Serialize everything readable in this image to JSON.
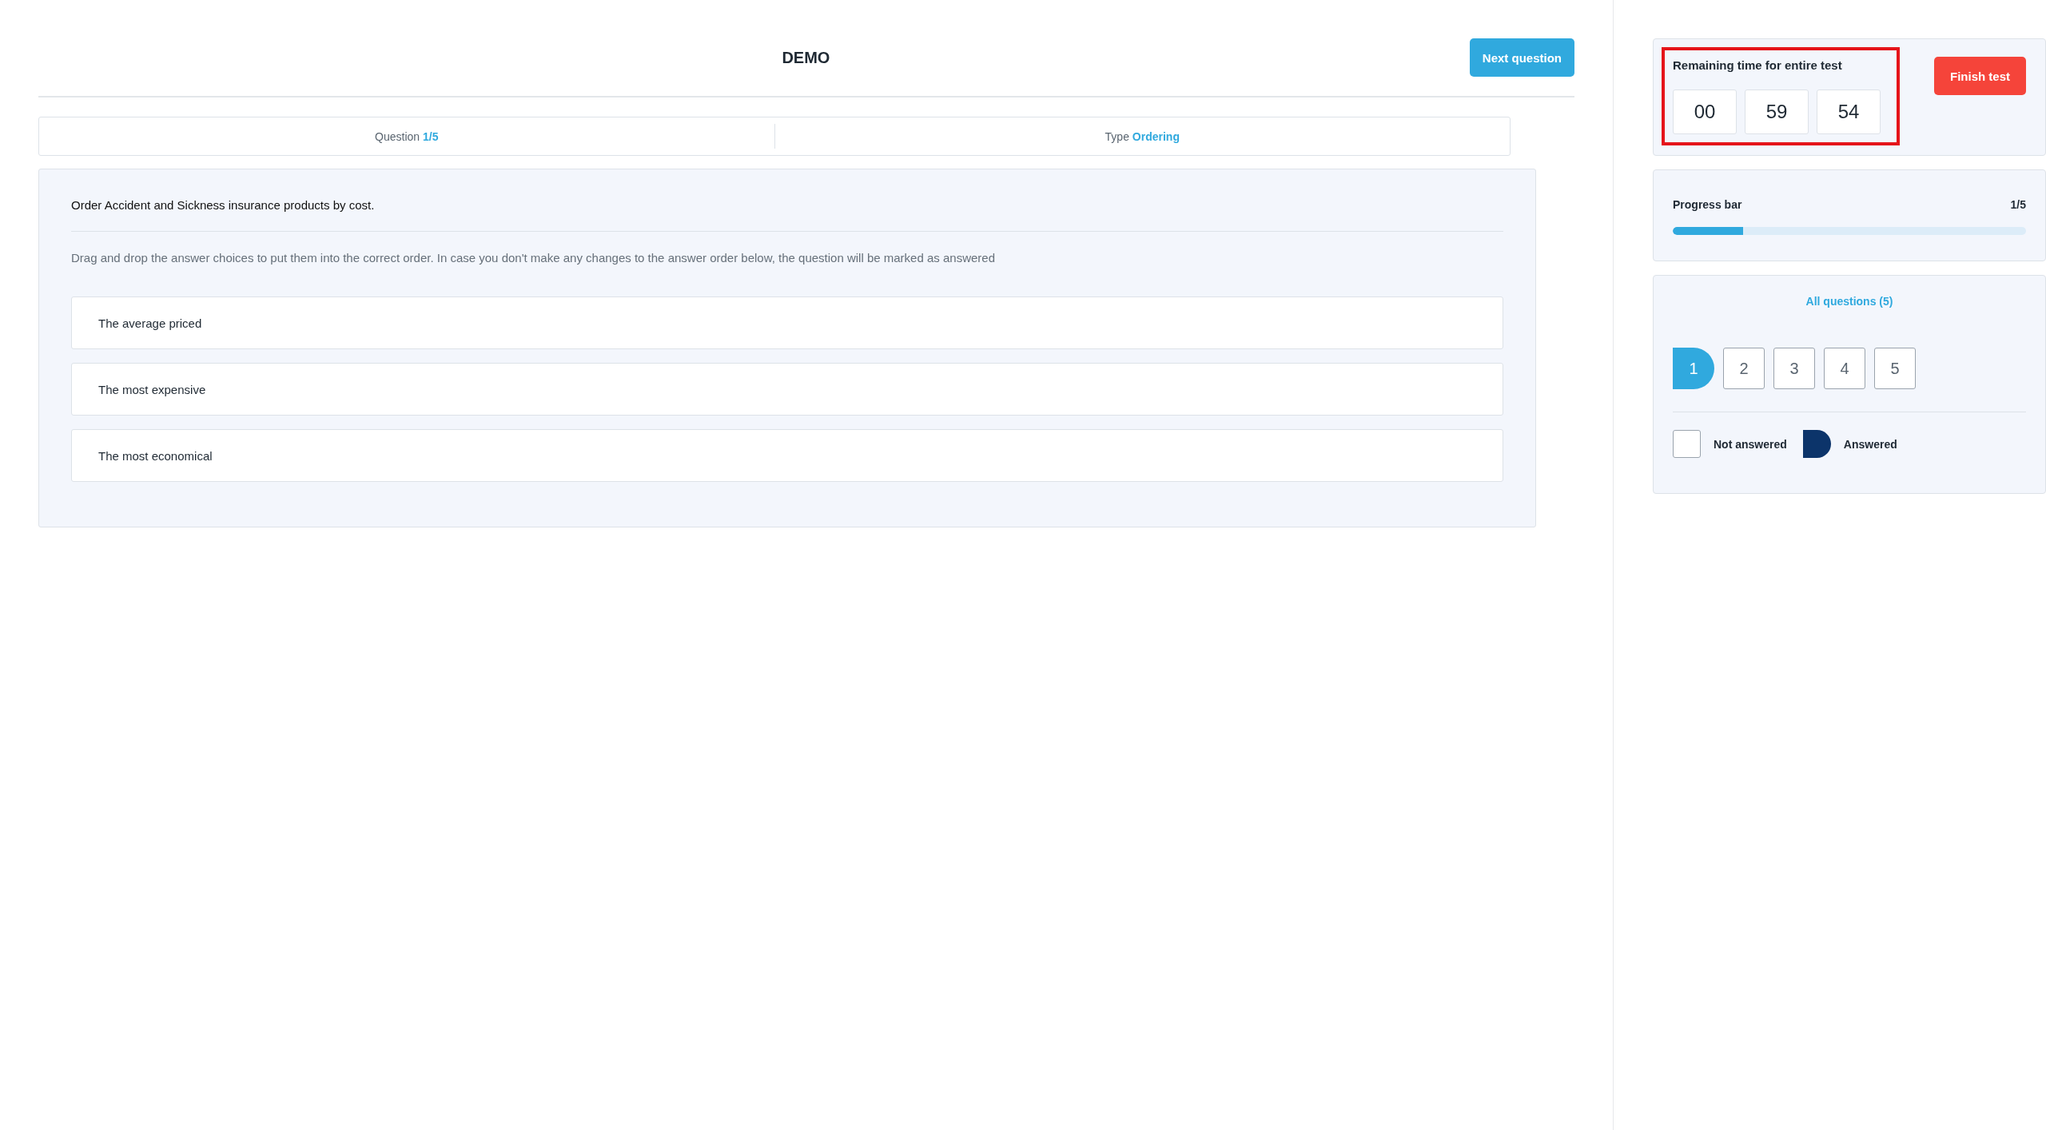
{
  "header": {
    "title": "DEMO",
    "next_button": "Next question"
  },
  "info_bar": {
    "question_label": "Question",
    "question_value": "1/5",
    "type_label": "Type",
    "type_value": "Ordering"
  },
  "question": {
    "prompt": "Order Accident and Sickness insurance products by cost.",
    "instructions": "Drag and drop the answer choices to put them into the correct order. In case you don't make any changes to the answer order below, the question will be marked as answered",
    "choices": [
      "The average priced",
      "The most expensive",
      "The most economical"
    ]
  },
  "timer": {
    "title": "Remaining time for entire test",
    "highlighted": true,
    "hours": "00",
    "minutes": "59",
    "seconds": "54",
    "finish_button": "Finish test"
  },
  "progress": {
    "title": "Progress bar",
    "count": "1/5",
    "level": 0.2
  },
  "navigator": {
    "title": "All questions (5)",
    "questions": [
      {
        "label": "1",
        "selected": true
      },
      {
        "label": "2",
        "selected": false
      },
      {
        "label": "3",
        "selected": false
      },
      {
        "label": "4",
        "selected": false
      },
      {
        "label": "5",
        "selected": false
      }
    ],
    "legend": [
      {
        "kind": "unanswered",
        "label": "Not answered"
      },
      {
        "kind": "answered",
        "label": "Answered"
      }
    ]
  }
}
